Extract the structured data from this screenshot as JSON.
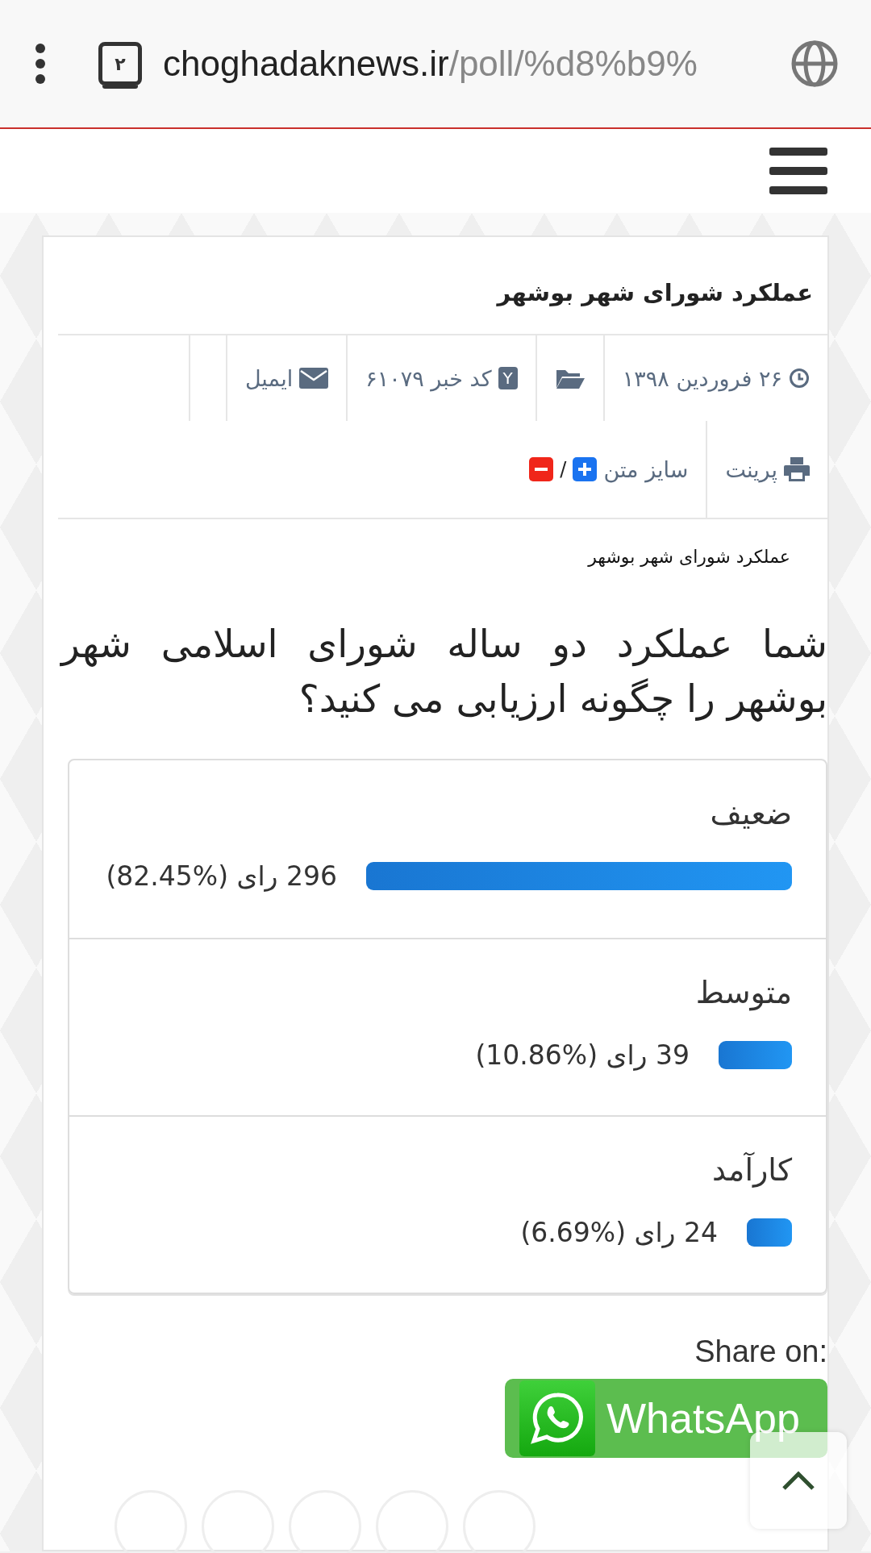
{
  "browser": {
    "tab_count": "۲",
    "url_host": "choghadaknews.ir",
    "url_path": "/poll/%d8%b9%"
  },
  "article": {
    "title": "عملکرد شورای شهر بوشهر",
    "meta": {
      "date": "۲۶ فروردین ۱۳۹۸",
      "code_badge": "Y",
      "code": "کد خبر ۶۱۰۷۹",
      "email": "ایمیل",
      "print": "پرینت",
      "text_size": "سایز متن",
      "separator": "/"
    },
    "subtitle": "عملکرد شورای شهر بوشهر",
    "question": "شما عملکرد دو ساله شورای اسلامی شهر بوشهر را چگونه ارزیابی می کنید؟"
  },
  "poll": [
    {
      "label": "ضعیف",
      "votes": "296 رای (%82.45)"
    },
    {
      "label": "متوسط",
      "votes": "39 رای (%10.86)"
    },
    {
      "label": "کارآمد",
      "votes": "24 رای (%6.69)"
    }
  ],
  "share": {
    "label": "Share on:",
    "whatsapp": "WhatsApp"
  }
}
